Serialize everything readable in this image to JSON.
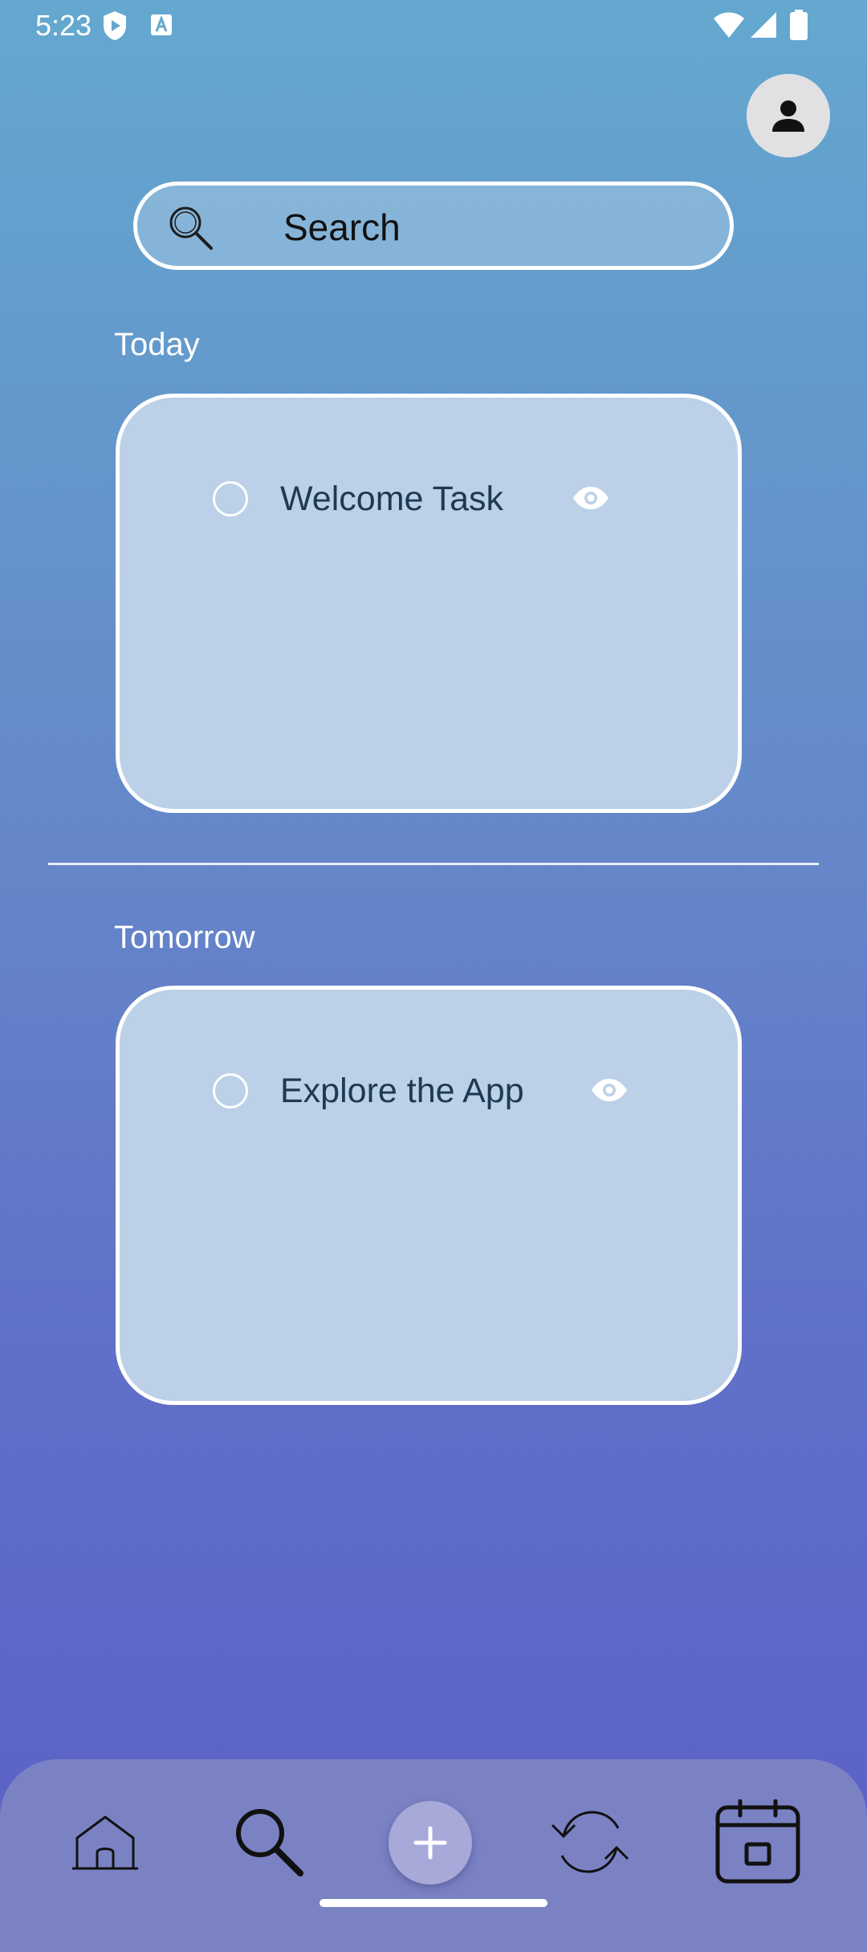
{
  "status_bar": {
    "time": "5:23",
    "left_icons": [
      "shield-play-icon",
      "text-a-icon"
    ],
    "right_icons": [
      "wifi-icon",
      "signal-icon",
      "battery-icon"
    ]
  },
  "profile": {
    "icon": "person-icon"
  },
  "search": {
    "label": "Search",
    "icon": "search-icon"
  },
  "sections": [
    {
      "label": "Today",
      "tasks": [
        {
          "title": "Welcome Task",
          "completed": false
        }
      ]
    },
    {
      "label": "Tomorrow",
      "tasks": [
        {
          "title": "Explore the App",
          "completed": false
        }
      ]
    }
  ],
  "bottom_nav": {
    "items": [
      "home-icon",
      "search-icon",
      "add-icon",
      "sync-icon",
      "calendar-icon"
    ]
  },
  "colors": {
    "gradient_top": "#64a8cf",
    "gradient_bottom": "#5b5fc8",
    "card_fill": "#bcd1e8",
    "task_text": "#1d3a52",
    "nav_bar": "#7b82c4",
    "fab": "#a7a9d9"
  }
}
